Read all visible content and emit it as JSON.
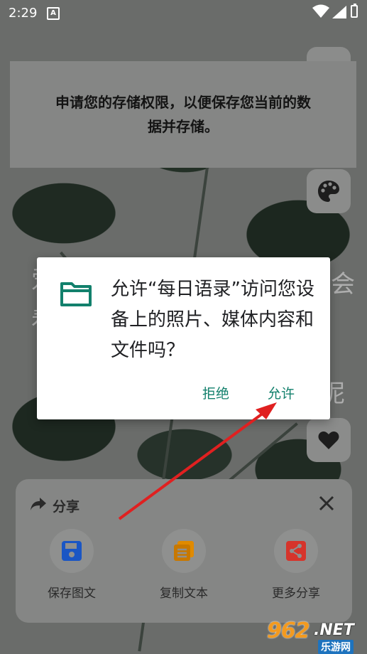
{
  "status_bar": {
    "time": "2:29",
    "notification_glyph": "A"
  },
  "background_text": {
    "left_chars": [
      "爱",
      "看"
    ],
    "right_chars": [
      "会",
      "呢"
    ]
  },
  "toast": {
    "message": "申请您的存储权限，以便保存您当前的数据并存储。"
  },
  "side_buttons": {
    "palette_icon": "palette-icon",
    "heart_icon": "heart-icon"
  },
  "permission_dialog": {
    "icon": "folder-icon",
    "message": "允许“每日语录”访问您设备上的照片、媒体内容和文件吗？",
    "deny_label": "拒绝",
    "allow_label": "允许"
  },
  "share_sheet": {
    "title": "分享",
    "items": [
      {
        "label": "保存图文",
        "icon": "save-icon",
        "color": "#1a56c4"
      },
      {
        "label": "复制文本",
        "icon": "copy-icon",
        "color": "#e08a00"
      },
      {
        "label": "更多分享",
        "icon": "share-icon",
        "color": "#d6342b"
      }
    ]
  },
  "annotation": {
    "arrow_color": "#e02020"
  },
  "watermark": {
    "number": "962",
    "suffix": ".NET",
    "site": "乐游网"
  }
}
